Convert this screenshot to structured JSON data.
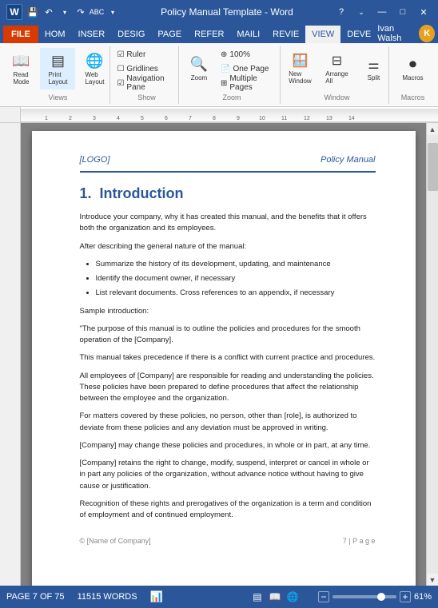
{
  "titlebar": {
    "title": "Policy Manual Template - Word",
    "help_icon": "?",
    "minimize_label": "—",
    "maximize_label": "□",
    "close_label": "✕"
  },
  "quickaccess": {
    "save_label": "💾",
    "undo_label": "↶",
    "redo_label": "↷",
    "customize_label": "▾"
  },
  "ribbon_tabs": [
    {
      "id": "file",
      "label": "FILE",
      "class": "file-tab"
    },
    {
      "id": "home",
      "label": "HOM",
      "class": ""
    },
    {
      "id": "insert",
      "label": "INSER",
      "class": ""
    },
    {
      "id": "design",
      "label": "DESIG",
      "class": ""
    },
    {
      "id": "page",
      "label": "PAGE",
      "class": ""
    },
    {
      "id": "references",
      "label": "REFER",
      "class": ""
    },
    {
      "id": "mailings",
      "label": "MAILI",
      "class": ""
    },
    {
      "id": "review",
      "label": "REVIE",
      "class": ""
    },
    {
      "id": "view",
      "label": "VIEW",
      "class": "active"
    },
    {
      "id": "developer",
      "label": "DEVE",
      "class": ""
    }
  ],
  "user": {
    "name": "Ivan Walsh",
    "avatar_letter": "K"
  },
  "document": {
    "logo_placeholder": "[LOGO]",
    "header_title": "Policy Manual",
    "section_number": "1.",
    "section_title": "Introduction",
    "paragraph1": "Introduce your company, why it has created this manual, and the benefits that it offers both the organization and its employees.",
    "paragraph2": "After describing the general nature of the manual:",
    "bullets": [
      "Summarize the history of its development, updating, and maintenance",
      "Identify the document owner, if necessary",
      "List relevant documents. Cross references to an appendix, if necessary"
    ],
    "sample_label": "Sample introduction:",
    "sample_quote": "\"The purpose of this manual is to outline the policies and procedures for the smooth operation of the [Company].",
    "para_precedence": "This manual takes precedence if there is a conflict with current practice and procedures.",
    "para_employees": "All employees of [Company] are responsible for reading and understanding the policies. These policies have been prepared to define procedures that affect the relationship between the employee and the organization.",
    "para_deviate": "For matters covered by these policies, no person, other than [role], is authorized to deviate from these policies and any deviation must be approved in writing.",
    "para_change": "[Company] may change these policies and procedures, in whole or in part, at any time.",
    "para_retain": "[Company] retains the right to change, modify, suspend, interpret or cancel in whole or in part any policies of the organization, without advance notice without having to give cause or justification.",
    "para_recognition": "Recognition of these rights and prerogatives of the organization is a term and condition of employment and of continued employment.",
    "footer_company": "© [Name of Company]",
    "footer_page": "7 | P a g e"
  },
  "statusbar": {
    "page_info": "PAGE 7 OF 75",
    "word_count": "11515 WORDS",
    "zoom_level": "61%"
  },
  "view_icons": {
    "print_layout": "▤",
    "web_layout": "⊞",
    "read_mode": "📖",
    "outline": "≡"
  }
}
